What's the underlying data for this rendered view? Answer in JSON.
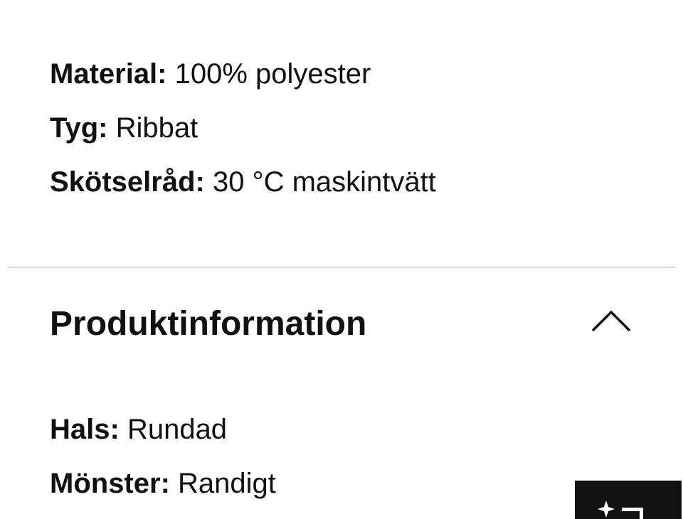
{
  "material_section": {
    "rows": [
      {
        "key": "Material:",
        "value": "100% polyester"
      },
      {
        "key": "Tyg:",
        "value": "Ribbat"
      },
      {
        "key": "Skötselråd:",
        "value": "30 °C maskintvätt"
      }
    ]
  },
  "product_info": {
    "title": "Produktinformation",
    "toggle_icon": "chevron-up-icon",
    "rows": [
      {
        "key": "Hals:",
        "value": "Rundad"
      },
      {
        "key": "Mönster:",
        "value": "Randigt"
      }
    ]
  },
  "floating_button": {
    "icon": "sparkle-icon"
  }
}
